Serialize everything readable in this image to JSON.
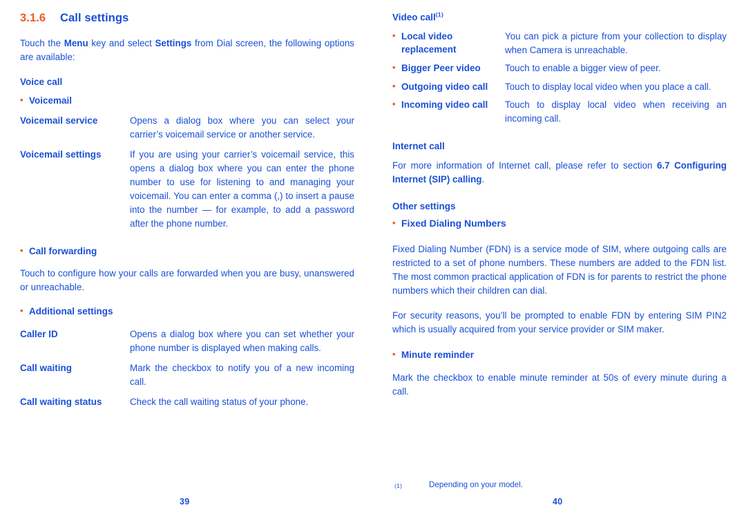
{
  "colors": {
    "blue": "#1a4fd6",
    "orange": "#f15a22",
    "background": "#ffffff"
  },
  "left_page": {
    "folio": "39",
    "section": {
      "number": "3.1.6",
      "title": "Call settings"
    },
    "intro": {
      "part1": "Touch the ",
      "bold1": "Menu",
      "part2": " key and select ",
      "bold2": "Settings",
      "part3": " from Dial screen, the following options are available:"
    },
    "voice_call_heading": "Voice call",
    "voicemail_bullet": "Voicemail",
    "voicemail_rows": [
      {
        "term": "Voicemail service",
        "desc": "Opens a dialog box where you can select your carrier’s voicemail service or another service."
      },
      {
        "term": "Voicemail settings",
        "desc": "If you are using your carrier’s voicemail service, this opens a dialog box where you can enter the phone number to use for listening to and managing your voicemail. You can enter a comma (,) to insert a pause into the number — for example, to add a password after the phone number."
      }
    ],
    "call_forwarding_bullet": "Call forwarding",
    "call_forwarding_text": "Touch to configure how your calls are forwarded when you are busy, unanswered or unreachable.",
    "additional_settings_bullet": "Additional settings",
    "additional_rows": [
      {
        "term": "Caller ID",
        "desc": "Opens a dialog box where you can set whether your phone number is displayed when making calls."
      },
      {
        "term": "Call waiting",
        "desc": "Mark the checkbox to notify you of a new incoming call."
      },
      {
        "term": "Call waiting status",
        "desc": "Check the call waiting status of your phone."
      }
    ]
  },
  "right_page": {
    "folio": "40",
    "video_call_heading": "Video call",
    "video_call_superscript": "(1)",
    "video_rows": [
      {
        "term": "Local video replacement",
        "desc": "You can pick a picture from your collection to display when Camera is unreachable."
      },
      {
        "term": "Bigger Peer video",
        "desc": "Touch to enable a bigger view of peer."
      },
      {
        "term": "Outgoing video call",
        "desc": "Touch to display local video when you place a call."
      },
      {
        "term": "Incoming video call",
        "desc": "Touch to display local video when receiving an incoming call."
      }
    ],
    "internet_call_heading": "Internet call",
    "internet_call": {
      "part1": "For more information of Internet call, please refer to section ",
      "bold1": "6.7 Configuring Internet (SIP) calling",
      "part2": "."
    },
    "other_settings_heading": "Other settings",
    "fdn_bullet": "Fixed Dialing Numbers",
    "fdn_paragraph_1": "Fixed Dialing Number (FDN) is a service mode of SIM, where outgoing calls are restricted to a set of phone numbers. These numbers are added to the FDN list. The most common practical application of FDN is for parents to restrict the phone numbers which their children can dial.",
    "fdn_paragraph_2": "For security reasons, you’ll be prompted to enable FDN by entering SIM PIN2 which is usually acquired from your service provider or SIM maker.",
    "minute_reminder_bullet": "Minute reminder",
    "minute_reminder_text": "Mark the checkbox to enable minute reminder at 50s of every minute during a call.",
    "footnote": {
      "mark": "(1)",
      "text": "Depending on your model."
    }
  }
}
